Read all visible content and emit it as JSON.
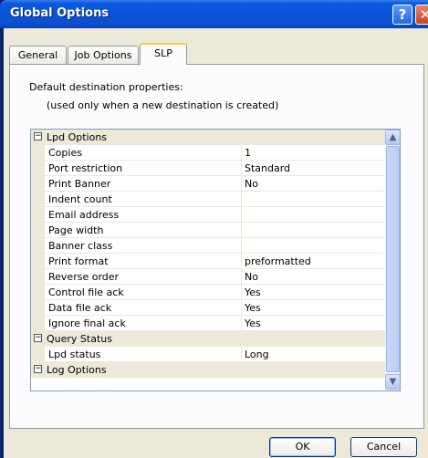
{
  "window": {
    "title": "Global Options",
    "help_glyph": "?",
    "close_glyph": "✕"
  },
  "tabs": [
    {
      "label": "General"
    },
    {
      "label": "Job Options"
    },
    {
      "label": "SLP"
    }
  ],
  "description": {
    "line1": "Default destination properties:",
    "line2": "(used only when a new destination is created)"
  },
  "grid": {
    "categories": [
      {
        "label": "Lpd Options",
        "toggle": "−"
      },
      {
        "label": "Query Status",
        "toggle": "−"
      },
      {
        "label": "Log Options",
        "toggle": "−"
      }
    ],
    "lpd_rows": [
      {
        "name": "Copies",
        "value": "1"
      },
      {
        "name": "Port restriction",
        "value": "Standard"
      },
      {
        "name": "Print Banner",
        "value": "No"
      },
      {
        "name": "Indent count",
        "value": ""
      },
      {
        "name": "Email address",
        "value": ""
      },
      {
        "name": "Page width",
        "value": ""
      },
      {
        "name": "Banner class",
        "value": ""
      },
      {
        "name": "Print format",
        "value": "preformatted"
      },
      {
        "name": "Reverse order",
        "value": "No"
      },
      {
        "name": "Control file ack",
        "value": "Yes"
      },
      {
        "name": "Data file ack",
        "value": "Yes"
      },
      {
        "name": "Ignore final ack",
        "value": "Yes"
      }
    ],
    "query_rows": [
      {
        "name": "Lpd status",
        "value": "Long"
      }
    ]
  },
  "buttons": {
    "ok": "OK",
    "cancel": "Cancel"
  }
}
